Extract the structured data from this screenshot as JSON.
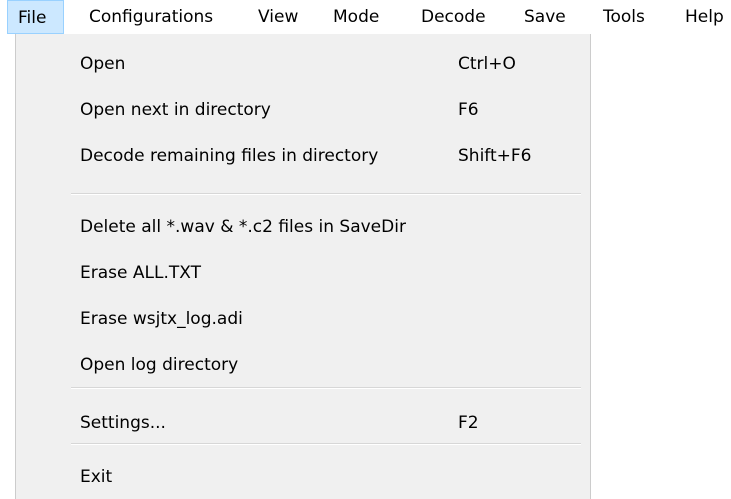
{
  "menubar": {
    "items": [
      {
        "label": "File",
        "active": true
      },
      {
        "label": "Configurations",
        "active": false
      },
      {
        "label": "View",
        "active": false
      },
      {
        "label": "Mode",
        "active": false
      },
      {
        "label": "Decode",
        "active": false
      },
      {
        "label": "Save",
        "active": false
      },
      {
        "label": "Tools",
        "active": false
      },
      {
        "label": "Help",
        "active": false
      }
    ]
  },
  "file_menu": {
    "items": [
      {
        "label": "Open",
        "shortcut": "Ctrl+O"
      },
      {
        "label": "Open next in directory",
        "shortcut": "F6"
      },
      {
        "label": "Decode remaining files in directory",
        "shortcut": "Shift+F6"
      },
      {
        "label": "Delete all *.wav & *.c2 files in SaveDir",
        "shortcut": ""
      },
      {
        "label": "Erase ALL.TXT",
        "shortcut": ""
      },
      {
        "label": "Erase wsjtx_log.adi",
        "shortcut": ""
      },
      {
        "label": "Open log directory",
        "shortcut": ""
      },
      {
        "label": "Settings...",
        "shortcut": "F2"
      },
      {
        "label": "Exit",
        "shortcut": ""
      }
    ]
  },
  "colors": {
    "menu_background": "#f0f0f0",
    "active_menubar_background": "#cce8ff",
    "active_menubar_border": "#99d1ff",
    "separator": "#d7d7d7"
  }
}
